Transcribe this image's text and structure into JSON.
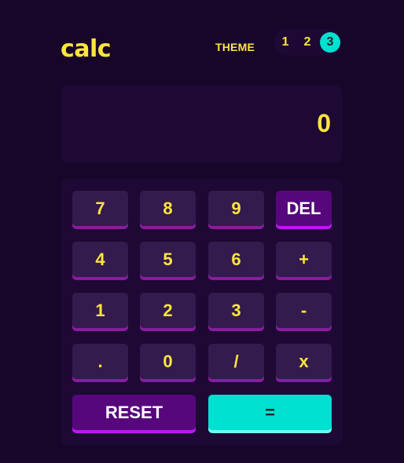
{
  "header": {
    "logo": "calc",
    "theme_label": "THEME",
    "theme_options": [
      "1",
      "2",
      "3"
    ],
    "active_theme": "3"
  },
  "display": {
    "value": "0"
  },
  "keypad": {
    "rows": [
      [
        "7",
        "8",
        "9",
        "DEL"
      ],
      [
        "4",
        "5",
        "6",
        "+"
      ],
      [
        "1",
        "2",
        "3",
        "-"
      ],
      [
        ".",
        "0",
        "/",
        "x"
      ]
    ],
    "reset_label": "RESET",
    "equals_label": "="
  },
  "colors": {
    "background": "#17062a",
    "panel": "#1d0934",
    "key": "#331b4d",
    "key_shadow": "#881c9e",
    "accent_text": "#ffe53d",
    "special_key": "#56077c",
    "equals_key": "#00e0d1"
  }
}
